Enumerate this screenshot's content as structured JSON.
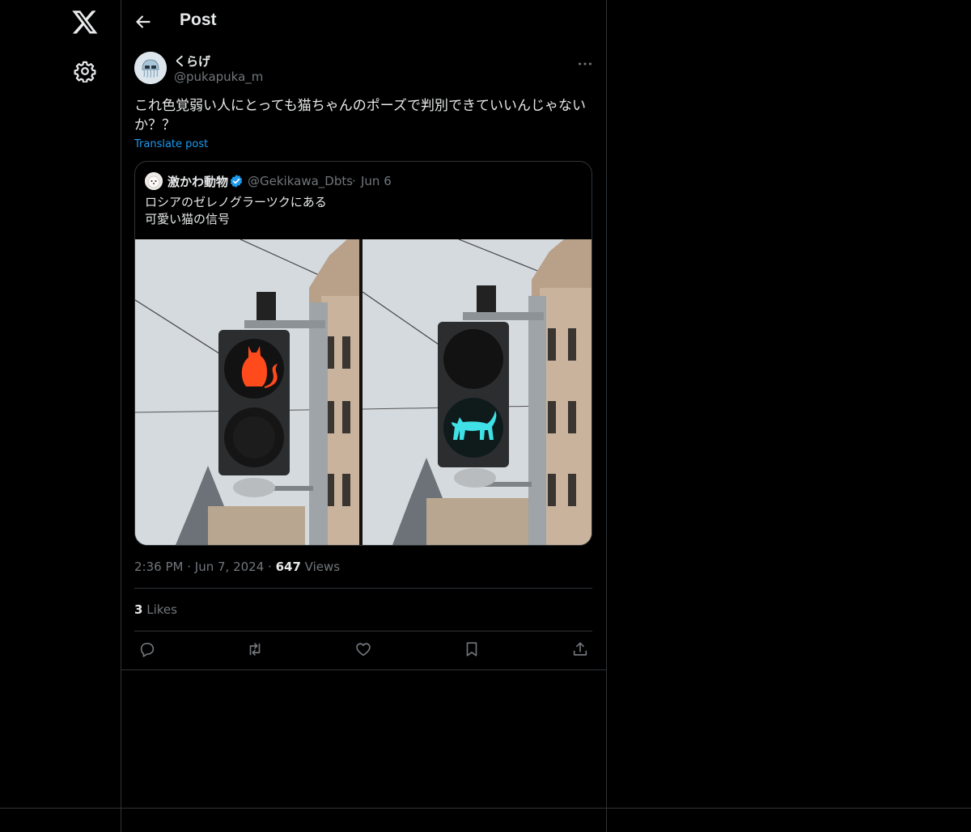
{
  "header": {
    "title": "Post"
  },
  "rail": {
    "logo_icon": "x-logo-icon",
    "settings_icon": "gear-icon"
  },
  "post": {
    "author_name": "くらげ",
    "author_handle": "@pukapuka_m",
    "text_line1": "これ色覚弱い人にとっても猫ちゃんのポーズで判別できていいんじゃない",
    "text_line2": "か？？",
    "translate_label": "Translate post",
    "time": "2:36 PM",
    "date": "Jun 7, 2024",
    "views_count": "647",
    "views_label": "Views",
    "likes_count": "3",
    "likes_label": "Likes"
  },
  "quote": {
    "author_name": "激かわ動物",
    "author_handle": "@Gekikawa_Dbts",
    "separator": "·",
    "date": "Jun 6",
    "text_line1": "ロシアのゼレノグラーツクにある",
    "text_line2": "可愛い猫の信号",
    "verified_color": "#1d9bf0"
  },
  "colors": {
    "background": "#000000",
    "text": "#e7e9ea",
    "secondary": "#71767b",
    "accent": "#1d9bf0",
    "border": "#2f3336",
    "signal_red": "#ff4a1c",
    "signal_cyan": "#3fe0e6"
  }
}
